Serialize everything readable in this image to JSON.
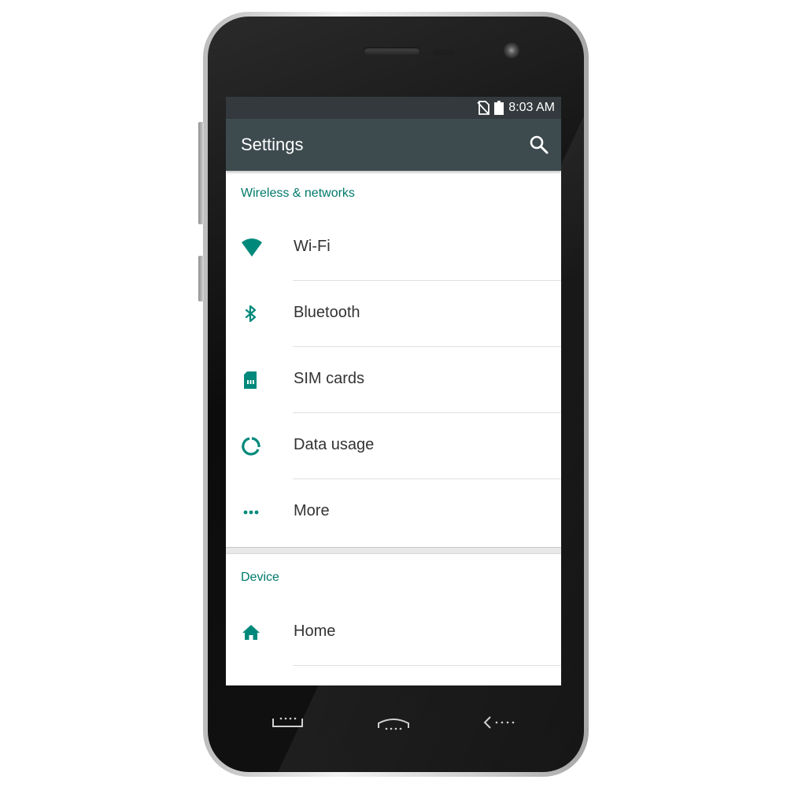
{
  "status_bar": {
    "time": "8:03 AM",
    "icons": [
      "no-sim-icon",
      "battery-icon"
    ]
  },
  "app_bar": {
    "title": "Settings",
    "action_icon": "search-icon"
  },
  "sections": [
    {
      "header": "Wireless & networks",
      "items": [
        {
          "label": "Wi-Fi",
          "icon": "wifi-icon"
        },
        {
          "label": "Bluetooth",
          "icon": "bluetooth-icon"
        },
        {
          "label": "SIM cards",
          "icon": "sim-card-icon"
        },
        {
          "label": "Data usage",
          "icon": "data-usage-icon"
        },
        {
          "label": "More",
          "icon": "more-dots-icon"
        }
      ]
    },
    {
      "header": "Device",
      "items": [
        {
          "label": "Home",
          "icon": "home-icon"
        }
      ]
    }
  ],
  "hardware_keys": [
    "menu-key-icon",
    "home-key-icon",
    "back-key-icon"
  ],
  "colors": {
    "accent": "#00796b",
    "app_bar": "#3d4b4f",
    "status_bar": "#33393c",
    "item_text": "#333333"
  }
}
